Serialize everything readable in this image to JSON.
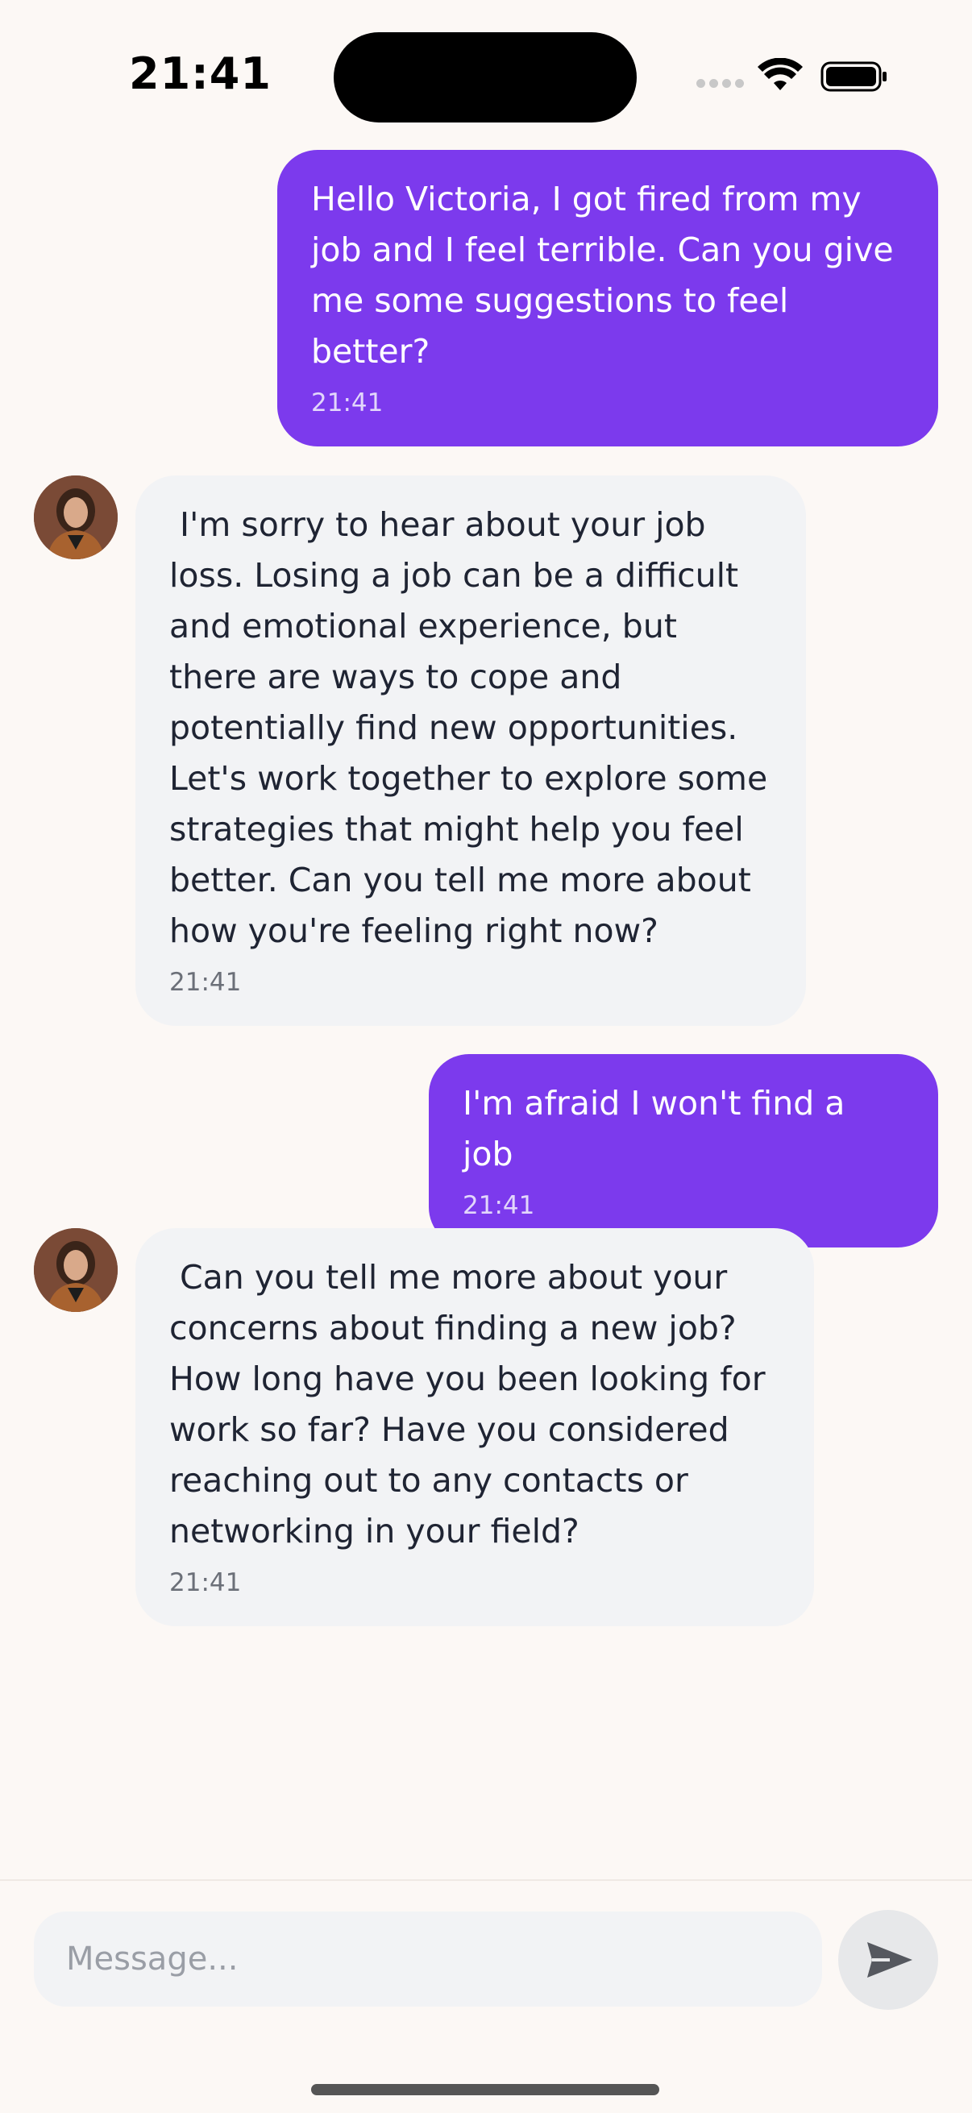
{
  "status_bar": {
    "time": "21:41"
  },
  "messages": [
    {
      "role": "user",
      "text": "Hello Victoria, I got fired from my\njob and I feel terrible. Can you give\nme some suggestions to feel\nbetter?",
      "time": "21:41"
    },
    {
      "role": "assistant",
      "text": " I'm sorry to hear about your job\nloss. Losing a job can be a difficult\nand emotional experience, but\nthere are ways to cope and\npotentially find new opportunities.\nLet's work together to explore some\nstrategies that might help you feel\nbetter. Can you tell me more about\nhow you're feeling right now?",
      "time": "21:41"
    },
    {
      "role": "user",
      "text": "I'm afraid I won't find a job",
      "time": "21:41"
    },
    {
      "role": "assistant",
      "text": " Can you tell me more about your\nconcerns about finding a new job?\nHow long have you been looking for\nwork so far? Have you considered\nreaching out to any contacts or\nnetworking in your field?",
      "time": "21:41"
    }
  ],
  "composer": {
    "placeholder": "Message...",
    "send_icon": "send-icon"
  },
  "colors": {
    "user_bubble": "#7c3aed",
    "assistant_bubble": "#f2f3f5",
    "background": "#fcf8f5"
  }
}
